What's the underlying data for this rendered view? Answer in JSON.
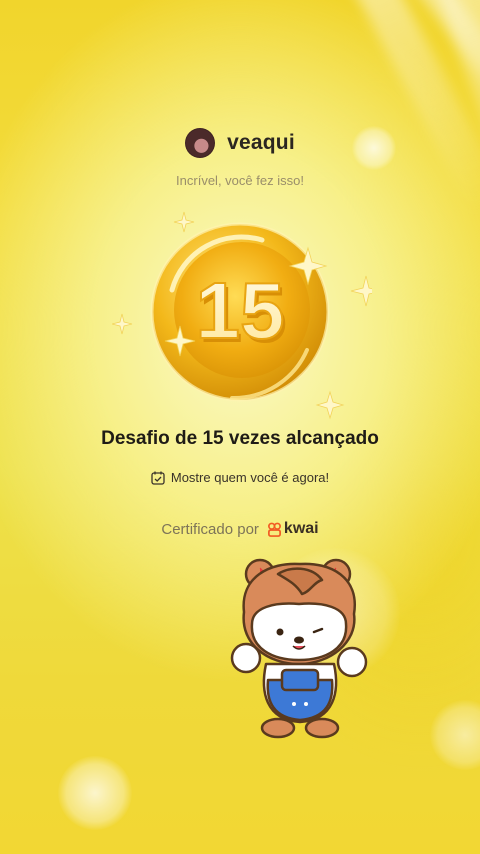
{
  "profile": {
    "username": "veaqui",
    "subtitle": "Incrível, você fez isso!"
  },
  "badge": {
    "number": "15",
    "title": "Desafio de 15 vezes alcançado",
    "prompt": "Mostre quem você é agora!"
  },
  "certification": {
    "label": "Certificado por",
    "brand": "kwai"
  },
  "colors": {
    "background": "#f1d52c",
    "gold": "#e9a20a",
    "brand": "#f25a23"
  },
  "icons": {
    "avatar": "avatar",
    "calendar": "calendar-check-icon",
    "logo": "kwai-logo-icon",
    "sticker": "bear-sticker"
  }
}
